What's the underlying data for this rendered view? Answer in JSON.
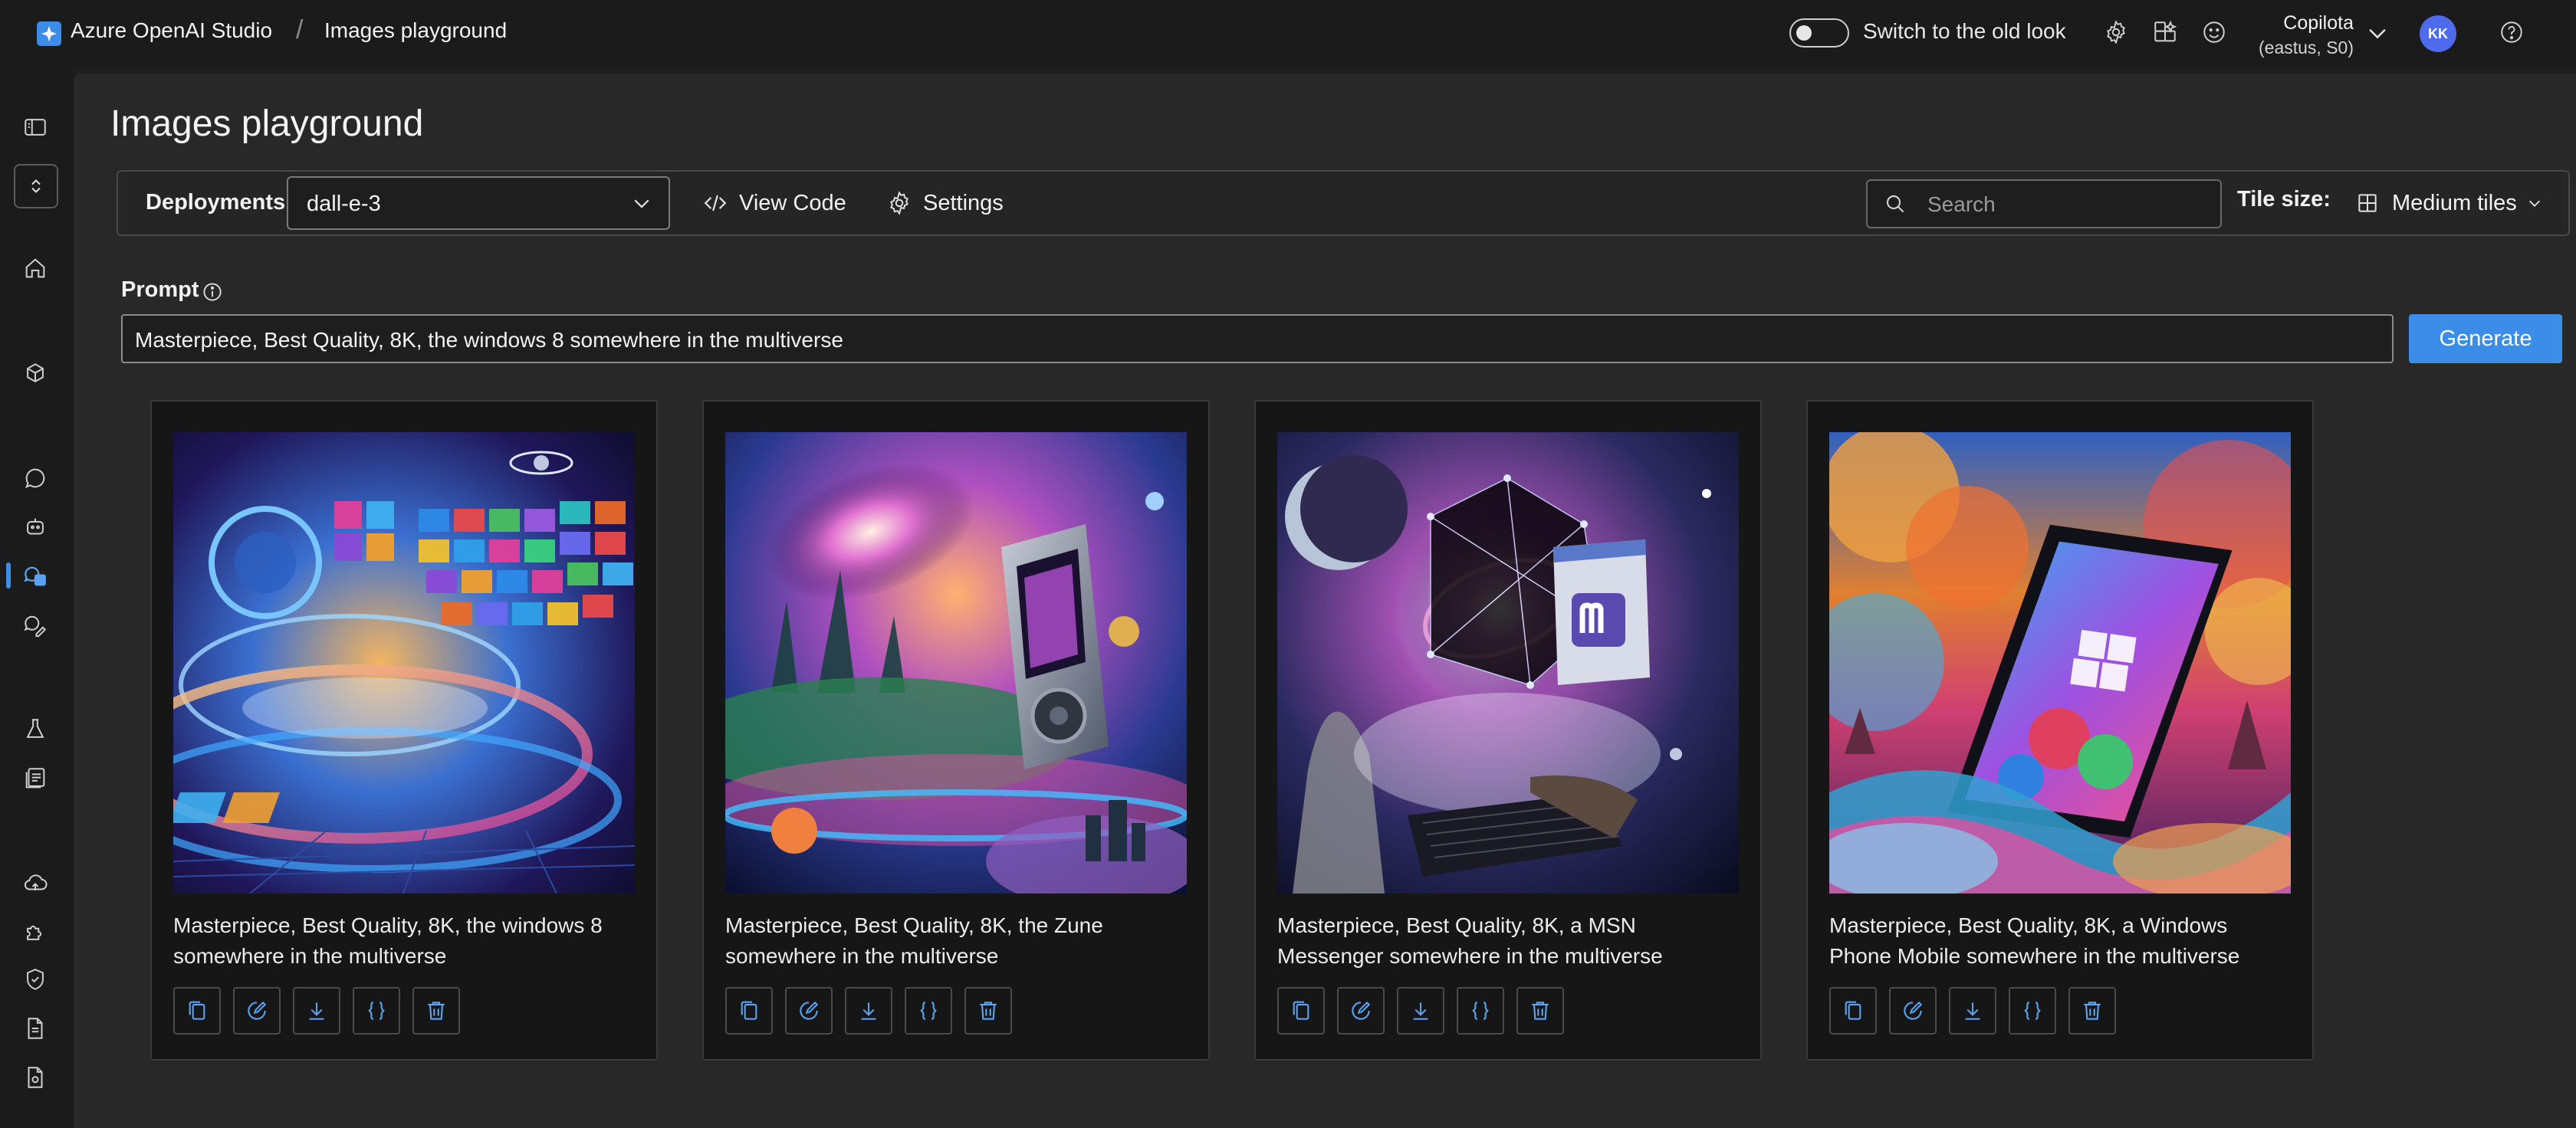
{
  "header": {
    "app_name": "Azure OpenAI Studio",
    "separator": "/",
    "breadcrumb": "Images playground",
    "toggle_label": "Switch to the old look",
    "account_name": "Copilota",
    "account_region": "(eastus, S0)",
    "avatar_initials": "KK"
  },
  "page": {
    "title": "Images playground"
  },
  "toolbar": {
    "deployments_label": "Deployments",
    "deployment_value": "dall-e-3",
    "view_code_label": "View Code",
    "settings_label": "Settings",
    "search_placeholder": "Search",
    "tile_size_label": "Tile size:",
    "tile_size_value": "Medium tiles"
  },
  "prompt": {
    "label": "Prompt",
    "value": "Masterpiece, Best Quality, 8K, the windows 8 somewhere in the multiverse",
    "generate_label": "Generate"
  },
  "results": [
    {
      "caption": "Masterpiece, Best Quality, 8K, the windows 8 somewhere in the multiverse"
    },
    {
      "caption": "Masterpiece, Best Quality, 8K, the Zune somewhere in the multiverse"
    },
    {
      "caption": "Masterpiece, Best Quality, 8K, a MSN Messenger somewhere in the multiverse"
    },
    {
      "caption": "Masterpiece, Best Quality, 8K, a Windows Phone Mobile somewhere in the multiverse"
    }
  ],
  "card_actions": [
    "copy-icon",
    "edit-icon",
    "download-icon",
    "code-icon",
    "delete-icon"
  ],
  "colors": {
    "accent": "#3b8de8",
    "background": "#282828",
    "topbar": "#1b1b1b",
    "card": "#161616"
  }
}
